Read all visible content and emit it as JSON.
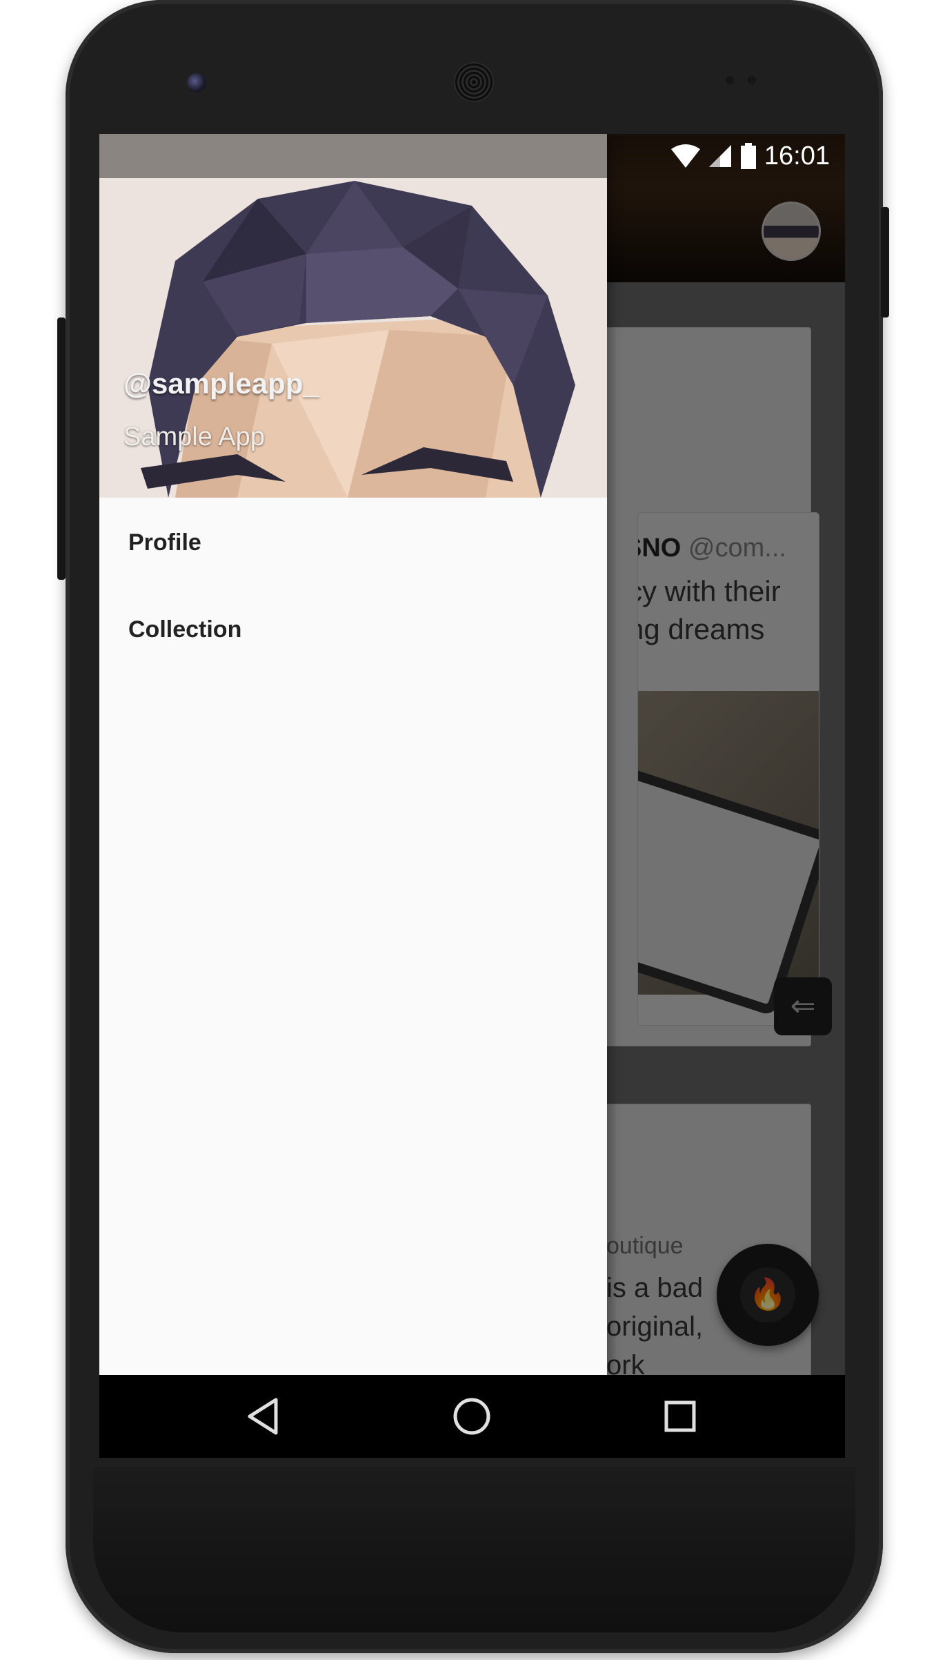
{
  "status_bar": {
    "time": "16:01"
  },
  "drawer": {
    "username": "@sampleapp_",
    "display_name": "Sample App",
    "menu": [
      {
        "label": "Profile"
      },
      {
        "label": "Collection"
      }
    ]
  },
  "background_feed": {
    "card1": {
      "author_fragment": "SNO",
      "handle_fragment": " @com...",
      "text_lines": [
        "cy with their",
        "ng dreams"
      ]
    },
    "card2": {
      "author_fragment": "outique",
      "text_lines": [
        "is a bad",
        "original,",
        "ork"
      ]
    }
  },
  "nav_bar": {
    "icons": [
      "back-icon",
      "home-icon",
      "recents-icon"
    ]
  },
  "colors": {
    "drawer_bg": "#fafafa",
    "scrim": "rgba(0,0,0,0.45)",
    "nav_bar": "#000000"
  }
}
